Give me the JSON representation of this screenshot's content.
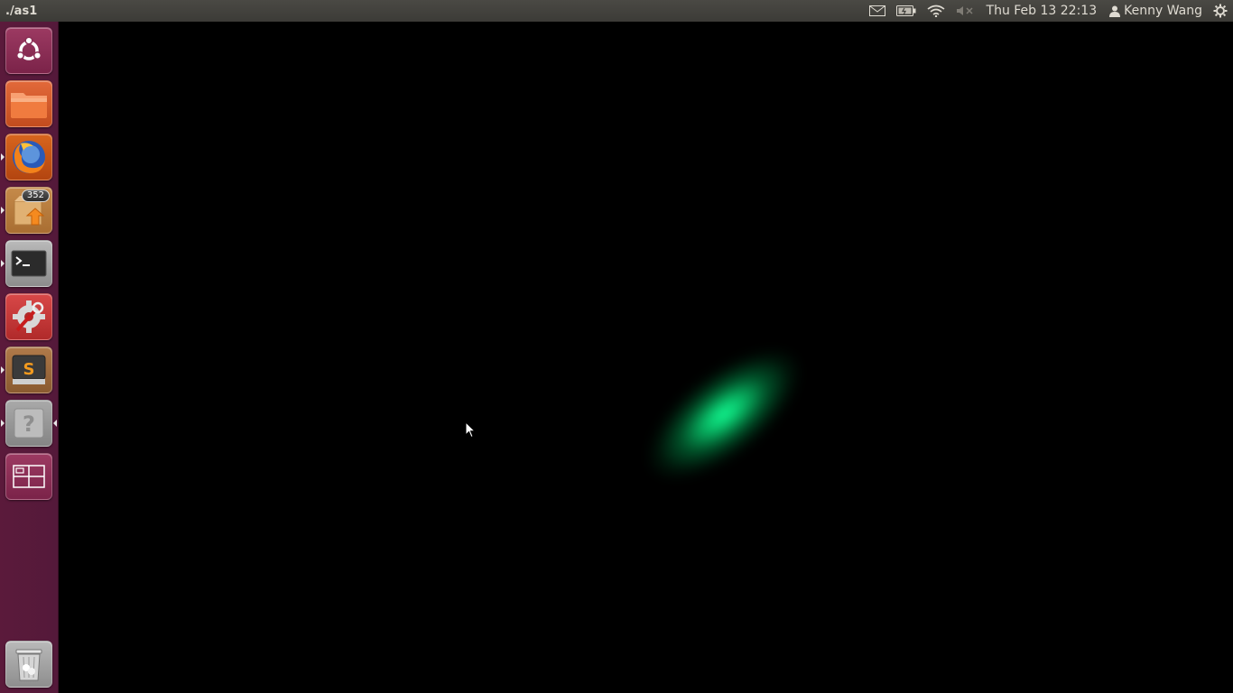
{
  "topbar": {
    "window_title": "./as1",
    "clock": "Thu Feb 13 22:13",
    "user_name": "Kenny Wang",
    "indicators": [
      "mail-icon",
      "battery-icon",
      "wifi-icon",
      "volume-muted-icon",
      "power-gear-icon"
    ]
  },
  "launcher": {
    "items": [
      {
        "name": "dash-home",
        "icon": "ubuntu-logo-icon"
      },
      {
        "name": "files",
        "icon": "folder-icon"
      },
      {
        "name": "firefox",
        "icon": "firefox-icon"
      },
      {
        "name": "software-updater",
        "icon": "update-box-icon",
        "badge": "352"
      },
      {
        "name": "terminal",
        "icon": "terminal-icon"
      },
      {
        "name": "system-settings",
        "icon": "settings-wrench-icon"
      },
      {
        "name": "sublime-text",
        "icon": "sublime-icon"
      },
      {
        "name": "unknown-app",
        "icon": "question-icon"
      },
      {
        "name": "workspace-switcher",
        "icon": "workspaces-icon"
      },
      {
        "name": "trash",
        "icon": "trash-icon"
      }
    ]
  },
  "colors": {
    "launcher_bg": "#5b1a3b",
    "topbar_bg": "#3c3b37",
    "glow": "#14ff96"
  }
}
